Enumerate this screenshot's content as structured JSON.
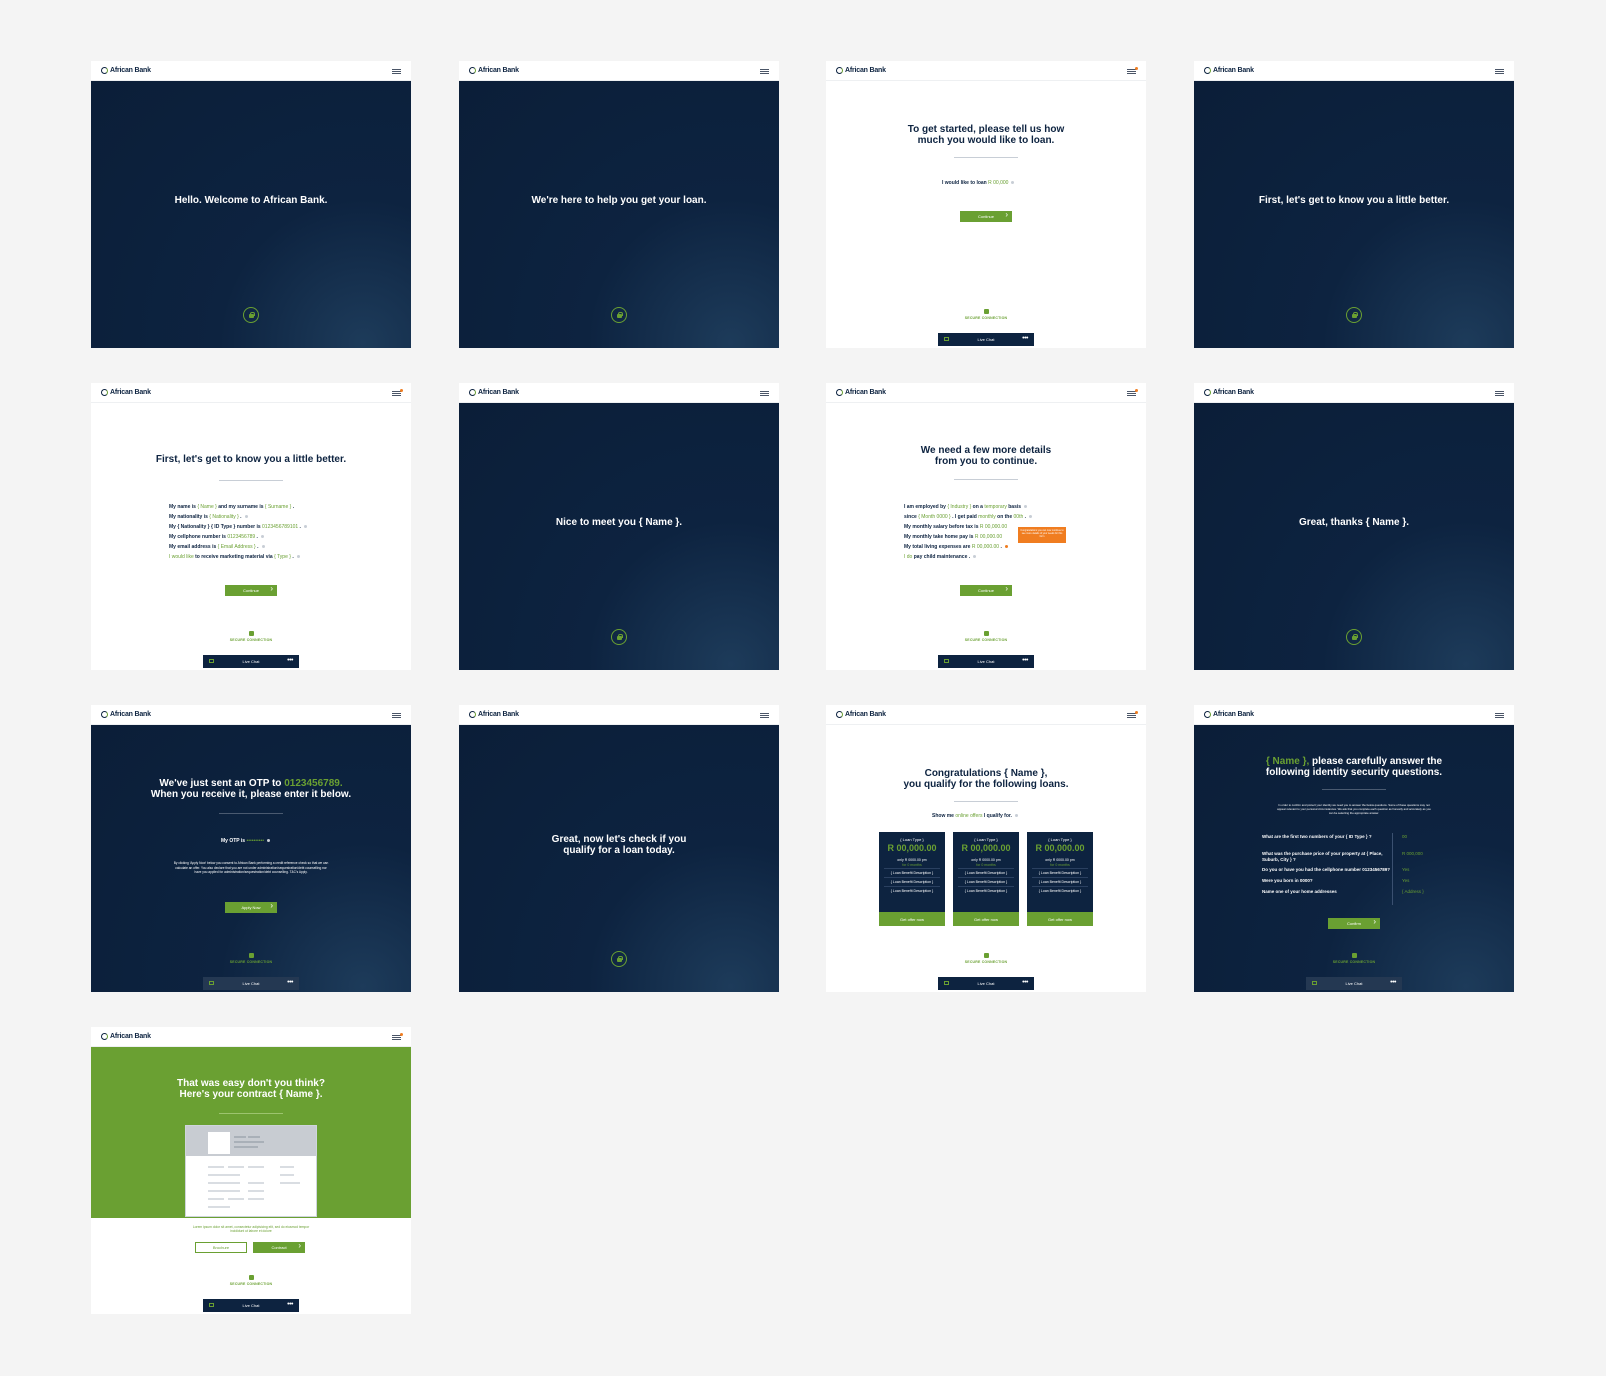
{
  "brand": {
    "name": "African Bank",
    "green": "#6aa032",
    "navy": "#0d2340"
  },
  "common": {
    "secure": "SECURE CONNECTION",
    "live_chat": "Live Chat",
    "more": "•••"
  },
  "s1": {
    "title": "Hello. Welcome to African Bank."
  },
  "s2": {
    "title": "We're here to help you get your loan."
  },
  "s3": {
    "title_l1": "To get started, please tell us how",
    "title_l2": "much you would like to loan.",
    "label": "I would like to loan",
    "value": "R 00,000",
    "button": "Continue"
  },
  "s4": {
    "title": "First, let's get to know you a little better."
  },
  "s5": {
    "title": "First, let's get to know you a little better.",
    "l1a": "My name is",
    "name": "{ Name }",
    "l1b": "and my surname is",
    "surname": "{ Surname }",
    "l2a": "My nationality is",
    "nationality": "{ Nationality }",
    "l3a": "My",
    "l3nat": "{ Nationality }",
    "l3id": "{ ID Type }",
    "l3b": "number is",
    "idnum": "0123456789101",
    "l4a": "My cellphone number is",
    "cell": "0123456789",
    "l5a": "My email address is",
    "email": "{ Email Address }",
    "would": "I would like",
    "l6b": "to receive marketing material via",
    "type": "{ Type }",
    "button": "Continue"
  },
  "s6": {
    "title": "Nice to meet you { Name }."
  },
  "s7": {
    "title_l1": "We need a few more details",
    "title_l2": "from you to continue.",
    "l1a": "I am employed by",
    "industry": "{ Industry }",
    "l1b": "on a",
    "temp": "temporary",
    "l1c": "basis",
    "l2a": "since",
    "month": "{ Month 0000 }",
    "l2b": ". I get paid",
    "monthly": "monthly",
    "l2c": "on the",
    "day": "00th",
    "l3a": "My monthly salary before tax is",
    "salary": "R 00,000.00",
    "l4a": "My monthly take home pay is",
    "takehome": "R 00,000.00",
    "l5a": "My total living expenses are",
    "expenses": "R 00,000.00",
    "do": "I do",
    "l6b": "pay child maintenance",
    "tooltip": "Congratulations you can now continue to see more details of your needs for this form",
    "button": "Continue"
  },
  "s8": {
    "title": "Great, thanks { Name }."
  },
  "s9": {
    "title_a": "We've just sent an OTP to",
    "phone": "0123456789.",
    "title_b": "When you receive it, please enter it below.",
    "otp_label": "My OTP is",
    "otp_value": "••••••••••",
    "legal": "By clicking 'Apply Now' below you consent to African Bank performing a credit reference check so that we can calculate an offer. You also declare that you are not under administration/sequestration/debt counselling nor have you applied for administration/sequestration/debt counselling. T&C's Apply.",
    "button": "Apply Now"
  },
  "s10": {
    "title_l1": "Great, now let's check if you",
    "title_l2": "qualify for a loan today."
  },
  "s11": {
    "title_l1": "Congratulations { Name },",
    "title_l2": "you qualify for the following loans.",
    "show": "Show me",
    "offers": "online offers",
    "qualify": "I qualify for.",
    "cards": [
      {
        "type": "{ Loan Type }",
        "amount": "R 00,000.00",
        "only": "only R 0000.00 pm",
        "for": "for 0 months",
        "desc": [
          "{ Loan Benefit Description }",
          "{ Loan Benefit Description }",
          "{ Loan Benefit Description }"
        ],
        "button": "Get offer now"
      },
      {
        "type": "{ Loan Type }",
        "amount": "R 00,000.00",
        "only": "only R 0000.00 pm",
        "for": "for 0 months",
        "desc": [
          "{ Loan Benefit Description }",
          "{ Loan Benefit Description }",
          "{ Loan Benefit Description }"
        ],
        "button": "Get offer now"
      },
      {
        "type": "{ Loan Type }",
        "amount": "R 00,000.00",
        "only": "only R 0000.00 pm",
        "for": "for 0 months",
        "desc": [
          "{ Loan Benefit Description }",
          "{ Loan Benefit Description }",
          "{ Loan Benefit Description }"
        ],
        "button": "Get offer now"
      }
    ]
  },
  "s12": {
    "name": "{ Name },",
    "title_a": "please carefully answer the",
    "title_b": "following identity security questions.",
    "intro": "In order to confirm and protect your identity we need you to answer the below questions. Some of these questions may not appear relevant to your personal circumstances. We ask that you complete each question as honestly and accurately as you can be selecting the appropriate answer.",
    "q1": "What are the first two numbers of your { ID Type } ?",
    "a1": "00",
    "q2": "What was the purchase price of your property at { Place, Suburb, City } ?",
    "a2": "R 000,000",
    "q3": "Do you or have you had the cellphone number 0123456789?",
    "a3": "Yes",
    "q4": "Were you born in 0000?",
    "a4": "Yes",
    "q5": "Name one of your home addresses",
    "a5": "{ Address }",
    "button": "Confirm"
  },
  "s13": {
    "title_l1": "That was easy don't you think?",
    "title_l2": "Here's your contract { Name }.",
    "lorem": "Lorem ipsum dolor sit amet, consectetur adipisicing elit, sed do eiusmod tempor incididunt ut labore et dolore",
    "brochure": "Brochure",
    "contract": "Contract"
  }
}
